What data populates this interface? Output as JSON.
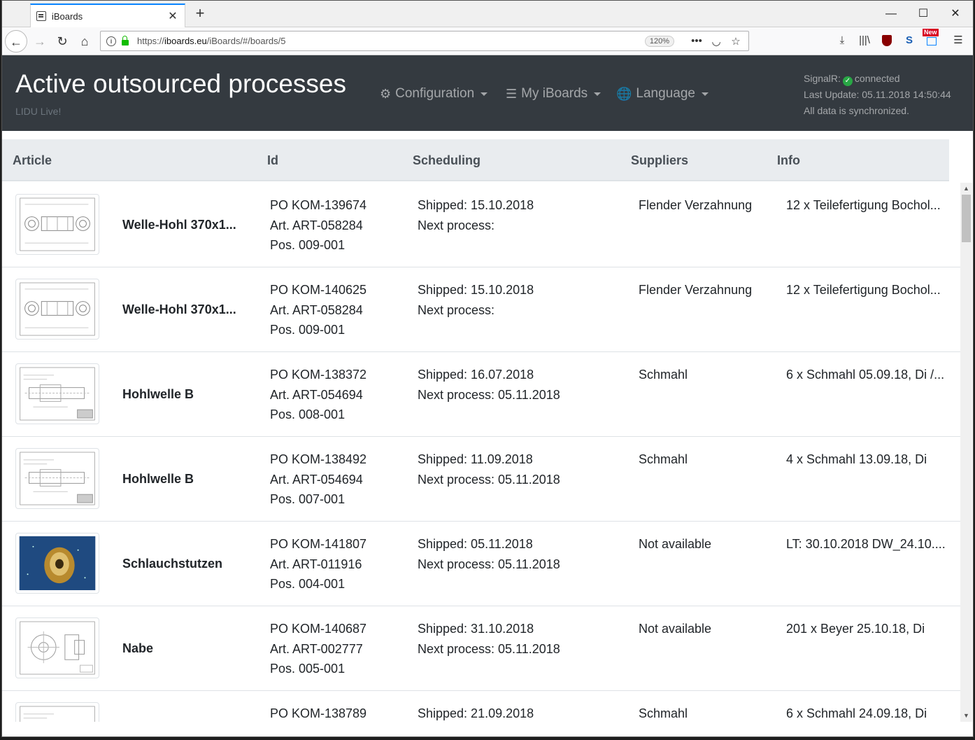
{
  "browser": {
    "tab_title": "iBoards",
    "url_prefix": "https://",
    "url_domain": "iboards.eu",
    "url_path": "/iBoards/#/boards/5",
    "zoom": "120%",
    "new_badge": "New"
  },
  "header": {
    "title": "Active outsourced processes",
    "subtitle": "LIDU Live!",
    "menus": {
      "configuration": "Configuration",
      "my_iboards": "My iBoards",
      "language": "Language"
    },
    "status": {
      "signalr_label": "SignalR:",
      "signalr_state": "connected",
      "last_update": "Last Update: 05.11.2018 14:50:44",
      "sync": "All data is synchronized."
    }
  },
  "table": {
    "columns": {
      "article": "Article",
      "id": "Id",
      "scheduling": "Scheduling",
      "suppliers": "Suppliers",
      "info": "Info"
    },
    "rows": [
      {
        "article": "Welle-Hohl 370x1...",
        "po": "PO KOM-139674",
        "art": "Art. ART-058284",
        "pos": "Pos. 009-001",
        "shipped": "Shipped: 15.10.2018",
        "next": "Next process:",
        "supplier": "Flender Verzahnung",
        "info": "12 x Teilefertigung Bochol..."
      },
      {
        "article": "Welle-Hohl 370x1...",
        "po": "PO KOM-140625",
        "art": "Art. ART-058284",
        "pos": "Pos. 009-001",
        "shipped": "Shipped: 15.10.2018",
        "next": "Next process:",
        "supplier": "Flender Verzahnung",
        "info": "12 x Teilefertigung Bochol..."
      },
      {
        "article": "Hohlwelle B",
        "po": "PO KOM-138372",
        "art": "Art. ART-054694",
        "pos": "Pos. 008-001",
        "shipped": "Shipped: 16.07.2018",
        "next": "Next process: 05.11.2018",
        "supplier": "Schmahl",
        "info": "6 x Schmahl 05.09.18, Di /..."
      },
      {
        "article": "Hohlwelle B",
        "po": "PO KOM-138492",
        "art": "Art. ART-054694",
        "pos": "Pos. 007-001",
        "shipped": "Shipped: 11.09.2018",
        "next": "Next process: 05.11.2018",
        "supplier": "Schmahl",
        "info": "4 x Schmahl 13.09.18, Di"
      },
      {
        "article": "Schlauchstutzen",
        "po": "PO KOM-141807",
        "art": "Art. ART-011916",
        "pos": "Pos. 004-001",
        "shipped": "Shipped: 05.11.2018",
        "next": "Next process: 05.11.2018",
        "supplier": "Not available",
        "info": "LT: 30.10.2018 DW_24.10...."
      },
      {
        "article": "Nabe",
        "po": "PO KOM-140687",
        "art": "Art. ART-002777",
        "pos": "Pos. 005-001",
        "shipped": "Shipped: 31.10.2018",
        "next": "Next process: 05.11.2018",
        "supplier": "Not available",
        "info": "201 x Beyer 25.10.18, Di"
      },
      {
        "article": "",
        "po": "PO KOM-138789",
        "art": "",
        "pos": "",
        "shipped": "Shipped: 21.09.2018",
        "next": "",
        "supplier": "Schmahl",
        "info": "6 x Schmahl 24.09.18, Di"
      }
    ]
  },
  "colors": {
    "header_bg": "#343a40",
    "table_head_bg": "#e9ecef",
    "status_ok": "#28a745",
    "url_lock": "#12bc00"
  }
}
